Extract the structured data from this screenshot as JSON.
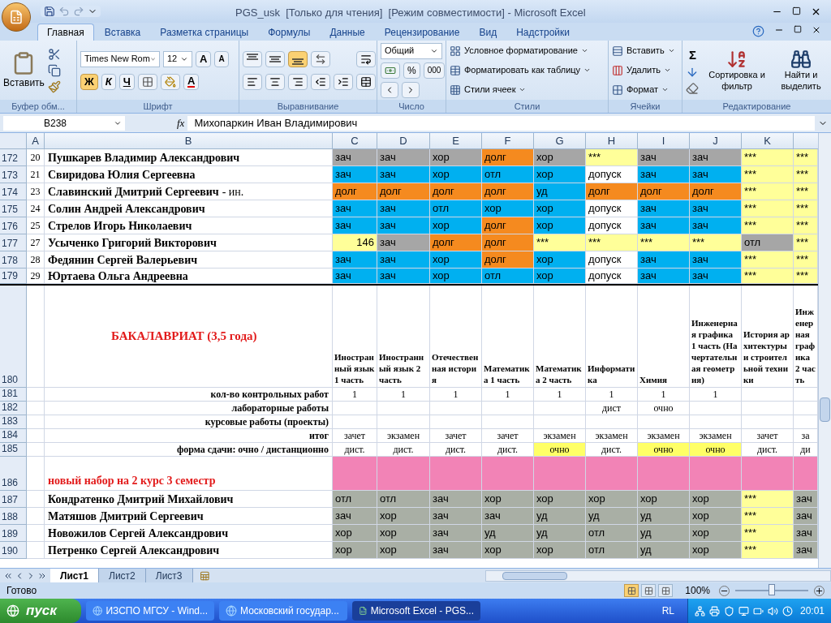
{
  "window": {
    "title": "PGS_usk  [Только для чтения]  [Режим совместимости] - Microsoft Excel"
  },
  "tabs": [
    {
      "label": "Главная",
      "selected": true
    },
    {
      "label": "Вставка",
      "selected": false
    },
    {
      "label": "Разметка страницы",
      "selected": false
    },
    {
      "label": "Формулы",
      "selected": false
    },
    {
      "label": "Данные",
      "selected": false
    },
    {
      "label": "Рецензирование",
      "selected": false
    },
    {
      "label": "Вид",
      "selected": false
    },
    {
      "label": "Надстройки",
      "selected": false
    }
  ],
  "ribbon": {
    "clipboard": {
      "label": "Буфер обм...",
      "paste": "Вставить"
    },
    "font": {
      "label": "Шрифт",
      "face": "Times New Rom",
      "size": "12",
      "grow": "A",
      "shrink": "A",
      "bold": {
        "text": "Ж",
        "selected": true
      },
      "italic": {
        "text": "К",
        "selected": false
      },
      "underline": {
        "text": "Ч",
        "selected": false
      },
      "font_color": "A"
    },
    "alignment": {
      "label": "Выравнивание",
      "valign": [
        {
          "selected": false
        },
        {
          "selected": false
        },
        {
          "selected": true
        }
      ]
    },
    "number": {
      "label": "Число",
      "format": "Общий",
      "percent": "%",
      "thousands": "000"
    },
    "styles": {
      "label": "Стили",
      "items": [
        "Условное форматирование",
        "Форматировать как таблицу",
        "Стили ячеек"
      ]
    },
    "cells": {
      "label": "Ячейки",
      "items": [
        "Вставить",
        "Удалить",
        "Формат"
      ]
    },
    "editing": {
      "label": "Редактирование",
      "sum": "Σ",
      "sort": "Сортировка и фильтр",
      "find": "Найти и выделить"
    }
  },
  "formula_bar": {
    "name_box": "B238",
    "fx": "fx",
    "value": "Михопаркин Иван Владимирович"
  },
  "sheet": {
    "columns": [
      "A",
      "B",
      "C",
      "D",
      "E",
      "F",
      "G",
      "H",
      "I",
      "J",
      "K"
    ],
    "rows": [
      {
        "kind": "student",
        "number": "172",
        "a": "20",
        "name": "Пушкарев Владимир Александрович",
        "cells": [
          {
            "text": "зач",
            "color": "#a6a6a6"
          },
          {
            "text": "зач",
            "color": "#a6a6a6"
          },
          {
            "text": "хор",
            "color": "#a6a6a6"
          },
          {
            "text": "долг",
            "color": "#f58a1f"
          },
          {
            "text": "хор",
            "color": "#a6a6a6"
          },
          {
            "text": "***",
            "color": "#ffff99"
          },
          {
            "text": "зач",
            "color": "#a6a6a6"
          },
          {
            "text": "зач",
            "color": "#a6a6a6"
          },
          {
            "text": "***",
            "color": "#ffff99"
          },
          {
            "text": "***",
            "color": "#ffff99"
          }
        ]
      },
      {
        "kind": "student",
        "number": "173",
        "a": "21",
        "name": "Свиридова Юлия Сергеевна",
        "cells": [
          {
            "text": "зач",
            "color": "#00b0f0"
          },
          {
            "text": "зач",
            "color": "#00b0f0"
          },
          {
            "text": "хор",
            "color": "#00b0f0"
          },
          {
            "text": "отл",
            "color": "#00b0f0"
          },
          {
            "text": "хор",
            "color": "#00b0f0"
          },
          {
            "text": "допуск",
            "color": "#ffffff"
          },
          {
            "text": "зач",
            "color": "#00b0f0"
          },
          {
            "text": "зач",
            "color": "#00b0f0"
          },
          {
            "text": "***",
            "color": "#ffff99"
          },
          {
            "text": "***",
            "color": "#ffff99"
          }
        ]
      },
      {
        "kind": "student",
        "number": "174",
        "a": "23",
        "name": "Славинский Дмитрий Сергеевич",
        "note": "- ин.",
        "cells": [
          {
            "text": "долг",
            "color": "#f58a1f"
          },
          {
            "text": "долг",
            "color": "#f58a1f"
          },
          {
            "text": "долг",
            "color": "#f58a1f"
          },
          {
            "text": "долг",
            "color": "#f58a1f"
          },
          {
            "text": "уд",
            "color": "#00b0f0"
          },
          {
            "text": "долг",
            "color": "#f58a1f"
          },
          {
            "text": "долг",
            "color": "#f58a1f"
          },
          {
            "text": "долг",
            "color": "#f58a1f"
          },
          {
            "text": "***",
            "color": "#ffff99"
          },
          {
            "text": "***",
            "color": "#ffff99"
          }
        ]
      },
      {
        "kind": "student",
        "number": "175",
        "a": "24",
        "name": "Солин Андрей Александрович",
        "cells": [
          {
            "text": "зач",
            "color": "#00b0f0"
          },
          {
            "text": "зач",
            "color": "#00b0f0"
          },
          {
            "text": "отл",
            "color": "#00b0f0"
          },
          {
            "text": "хор",
            "color": "#00b0f0"
          },
          {
            "text": "хор",
            "color": "#00b0f0"
          },
          {
            "text": "допуск",
            "color": "#ffffff"
          },
          {
            "text": "зач",
            "color": "#00b0f0"
          },
          {
            "text": "зач",
            "color": "#00b0f0"
          },
          {
            "text": "***",
            "color": "#ffff99"
          },
          {
            "text": "***",
            "color": "#ffff99"
          }
        ]
      },
      {
        "kind": "student",
        "number": "176",
        "a": "25",
        "name": "Стрелов Игорь Николаевич",
        "cells": [
          {
            "text": "зач",
            "color": "#00b0f0"
          },
          {
            "text": "зач",
            "color": "#00b0f0"
          },
          {
            "text": "хор",
            "color": "#00b0f0"
          },
          {
            "text": "долг",
            "color": "#f58a1f"
          },
          {
            "text": "хор",
            "color": "#00b0f0"
          },
          {
            "text": "допуск",
            "color": "#ffffff"
          },
          {
            "text": "зач",
            "color": "#00b0f0"
          },
          {
            "text": "зач",
            "color": "#00b0f0"
          },
          {
            "text": "***",
            "color": "#ffff99"
          },
          {
            "text": "***",
            "color": "#ffff99"
          }
        ]
      },
      {
        "kind": "student",
        "number": "177",
        "a": "27",
        "name": "Усыченко Григорий Викторович",
        "cells": [
          {
            "text": "146",
            "color": "#ffff99",
            "numeric": true
          },
          {
            "text": "зач",
            "color": "#a6a6a6"
          },
          {
            "text": "долг",
            "color": "#f58a1f"
          },
          {
            "text": "долг",
            "color": "#f58a1f"
          },
          {
            "text": "***",
            "color": "#ffff99"
          },
          {
            "text": "***",
            "color": "#ffff99"
          },
          {
            "text": "***",
            "color": "#ffff99"
          },
          {
            "text": "***",
            "color": "#ffff99"
          },
          {
            "text": "отл",
            "color": "#a6a6a6"
          },
          {
            "text": "***",
            "color": "#ffff99"
          }
        ]
      },
      {
        "kind": "student",
        "number": "178",
        "a": "28",
        "name": "Федянин Сергей Валерьевич",
        "cells": [
          {
            "text": "зач",
            "color": "#00b0f0"
          },
          {
            "text": "зач",
            "color": "#00b0f0"
          },
          {
            "text": "хор",
            "color": "#00b0f0"
          },
          {
            "text": "долг",
            "color": "#f58a1f"
          },
          {
            "text": "хор",
            "color": "#00b0f0"
          },
          {
            "text": "допуск",
            "color": "#ffffff"
          },
          {
            "text": "зач",
            "color": "#00b0f0"
          },
          {
            "text": "зач",
            "color": "#00b0f0"
          },
          {
            "text": "***",
            "color": "#ffff99"
          },
          {
            "text": "***",
            "color": "#ffff99"
          }
        ]
      },
      {
        "kind": "student",
        "number": "179",
        "a": "29",
        "name": "Юртаева Ольга Андреевна",
        "cells": [
          {
            "text": "зач",
            "color": "#00b0f0"
          },
          {
            "text": "зач",
            "color": "#00b0f0"
          },
          {
            "text": "хор",
            "color": "#00b0f0"
          },
          {
            "text": "отл",
            "color": "#00b0f0"
          },
          {
            "text": "хор",
            "color": "#00b0f0"
          },
          {
            "text": "допуск",
            "color": "#ffffff"
          },
          {
            "text": "зач",
            "color": "#00b0f0"
          },
          {
            "text": "зач",
            "color": "#00b0f0"
          },
          {
            "text": "***",
            "color": "#ffff99"
          },
          {
            "text": "***",
            "color": "#ffff99"
          }
        ]
      },
      {
        "kind": "header",
        "number": "180",
        "name": "БАКАЛАВРИАТ (3,5 года)",
        "cells": [
          {
            "text": "Иностранный язык 1 часть"
          },
          {
            "text": "Иностранный язык 2 часть"
          },
          {
            "text": "Отечественная история"
          },
          {
            "text": "Математика 1 часть"
          },
          {
            "text": "Математика 2 часть"
          },
          {
            "text": "Информатика"
          },
          {
            "text": "Химия"
          },
          {
            "text": "Инженерная графика 1 часть (Начертательная геометрия)"
          },
          {
            "text": "История архитектуры и строительной техники"
          },
          {
            "text": "Инженерная графика 2 часть"
          }
        ]
      },
      {
        "kind": "info",
        "number": "181",
        "name": "кол-во контрольных работ",
        "cells": [
          {
            "text": "1"
          },
          {
            "text": "1"
          },
          {
            "text": "1"
          },
          {
            "text": "1"
          },
          {
            "text": "1"
          },
          {
            "text": "1"
          },
          {
            "text": "1"
          },
          {
            "text": "1"
          },
          {},
          {}
        ]
      },
      {
        "kind": "info",
        "number": "182",
        "name": "лабораторные работы",
        "cells": [
          {},
          {},
          {},
          {},
          {},
          {
            "text": "дист"
          },
          {
            "text": "очно"
          },
          {},
          {},
          {}
        ]
      },
      {
        "kind": "info",
        "number": "183",
        "name": "курсовые работы (проекты)",
        "cells": [
          {},
          {},
          {},
          {},
          {},
          {},
          {},
          {},
          {},
          {}
        ]
      },
      {
        "kind": "info",
        "number": "184",
        "name": "итог",
        "cells": [
          {
            "text": "зачет"
          },
          {
            "text": "экзамен"
          },
          {
            "text": "зачет"
          },
          {
            "text": "зачет"
          },
          {
            "text": "экзамен"
          },
          {
            "text": "экзамен"
          },
          {
            "text": "экзамен"
          },
          {
            "text": "экзамен"
          },
          {
            "text": "зачет"
          },
          {
            "text": "за"
          }
        ]
      },
      {
        "kind": "info",
        "number": "185",
        "name": "форма сдачи: очно / дистанционно",
        "cells": [
          {
            "text": "дист."
          },
          {
            "text": "дист."
          },
          {
            "text": "дист."
          },
          {
            "text": "дист."
          },
          {
            "text": "очно",
            "color": "#ffff66"
          },
          {
            "text": "дист."
          },
          {
            "text": "очно",
            "color": "#ffff66"
          },
          {
            "text": "очно",
            "color": "#ffff66"
          },
          {
            "text": "дист."
          },
          {
            "text": "ди"
          }
        ]
      },
      {
        "kind": "section",
        "number": "186",
        "name": "новый набор на 2 курс 3 семестр",
        "cells": [
          {
            "color": "#f283b6"
          },
          {
            "color": "#f283b6"
          },
          {
            "color": "#f283b6"
          },
          {
            "color": "#f283b6"
          },
          {
            "color": "#f283b6"
          },
          {
            "color": "#f283b6"
          },
          {
            "color": "#f283b6"
          },
          {
            "color": "#f283b6"
          },
          {
            "color": "#f283b6"
          },
          {
            "color": "#f283b6"
          }
        ]
      },
      {
        "kind": "student",
        "number": "187",
        "name": "Кондратенко Дмитрий Михайлович",
        "cells": [
          {
            "text": "отл",
            "color": "#a9afa5"
          },
          {
            "text": "отл",
            "color": "#a9afa5"
          },
          {
            "text": "зач",
            "color": "#a9afa5"
          },
          {
            "text": "хор",
            "color": "#a9afa5"
          },
          {
            "text": "хор",
            "color": "#a9afa5"
          },
          {
            "text": "хор",
            "color": "#a9afa5"
          },
          {
            "text": "хор",
            "color": "#a9afa5"
          },
          {
            "text": "хор",
            "color": "#a9afa5"
          },
          {
            "text": "***",
            "color": "#ffff99"
          },
          {
            "text": "зач",
            "color": "#a9afa5"
          }
        ]
      },
      {
        "kind": "student",
        "number": "188",
        "name": "Матяшов Дмитрий Сергеевич",
        "cells": [
          {
            "text": "зач",
            "color": "#a9afa5"
          },
          {
            "text": "хор",
            "color": "#a9afa5"
          },
          {
            "text": "зач",
            "color": "#a9afa5"
          },
          {
            "text": "зач",
            "color": "#a9afa5"
          },
          {
            "text": "уд",
            "color": "#a9afa5"
          },
          {
            "text": "уд",
            "color": "#a9afa5"
          },
          {
            "text": "уд",
            "color": "#a9afa5"
          },
          {
            "text": "хор",
            "color": "#a9afa5"
          },
          {
            "text": "***",
            "color": "#ffff99"
          },
          {
            "text": "зач",
            "color": "#a9afa5"
          }
        ]
      },
      {
        "kind": "student",
        "number": "189",
        "name": "Новожилов Сергей Александрович",
        "cells": [
          {
            "text": "хор",
            "color": "#a9afa5"
          },
          {
            "text": "хор",
            "color": "#a9afa5"
          },
          {
            "text": "зач",
            "color": "#a9afa5"
          },
          {
            "text": "уд",
            "color": "#a9afa5"
          },
          {
            "text": "уд",
            "color": "#a9afa5"
          },
          {
            "text": "отл",
            "color": "#a9afa5"
          },
          {
            "text": "уд",
            "color": "#a9afa5"
          },
          {
            "text": "хор",
            "color": "#a9afa5"
          },
          {
            "text": "***",
            "color": "#ffff99"
          },
          {
            "text": "зач",
            "color": "#a9afa5"
          }
        ]
      },
      {
        "kind": "student",
        "number": "190",
        "name": "Петренко Сергей Александрович",
        "cells": [
          {
            "text": "хор",
            "color": "#a9afa5"
          },
          {
            "text": "хор",
            "color": "#a9afa5"
          },
          {
            "text": "зач",
            "color": "#a9afa5"
          },
          {
            "text": "хор",
            "color": "#a9afa5"
          },
          {
            "text": "хор",
            "color": "#a9afa5"
          },
          {
            "text": "отл",
            "color": "#a9afa5"
          },
          {
            "text": "уд",
            "color": "#a9afa5"
          },
          {
            "text": "хор",
            "color": "#a9afa5"
          },
          {
            "text": "***",
            "color": "#ffff99"
          },
          {
            "text": "зач",
            "color": "#a9afa5"
          }
        ]
      }
    ]
  },
  "sheet_tabs": [
    {
      "label": "Лист1",
      "selected": true
    },
    {
      "label": "Лист2",
      "selected": false
    },
    {
      "label": "Лист3",
      "selected": false
    }
  ],
  "status_bar": {
    "text": "Готово",
    "zoom": "100%",
    "zoom_slider": {
      "level": 0.5
    },
    "views": [
      {
        "selected": true
      },
      {
        "selected": false
      },
      {
        "selected": false
      }
    ]
  },
  "taskbar": {
    "start": "пуск",
    "tasks": [
      {
        "label": "ИЗСПО МГСУ - Wind...",
        "kind": "browser",
        "selected": false
      },
      {
        "label": "Московский государ...",
        "kind": "browser",
        "selected": false
      },
      {
        "label": "Microsoft Excel - PGS...",
        "kind": "excel",
        "selected": true
      }
    ],
    "language": "RL",
    "time": "20:01"
  }
}
